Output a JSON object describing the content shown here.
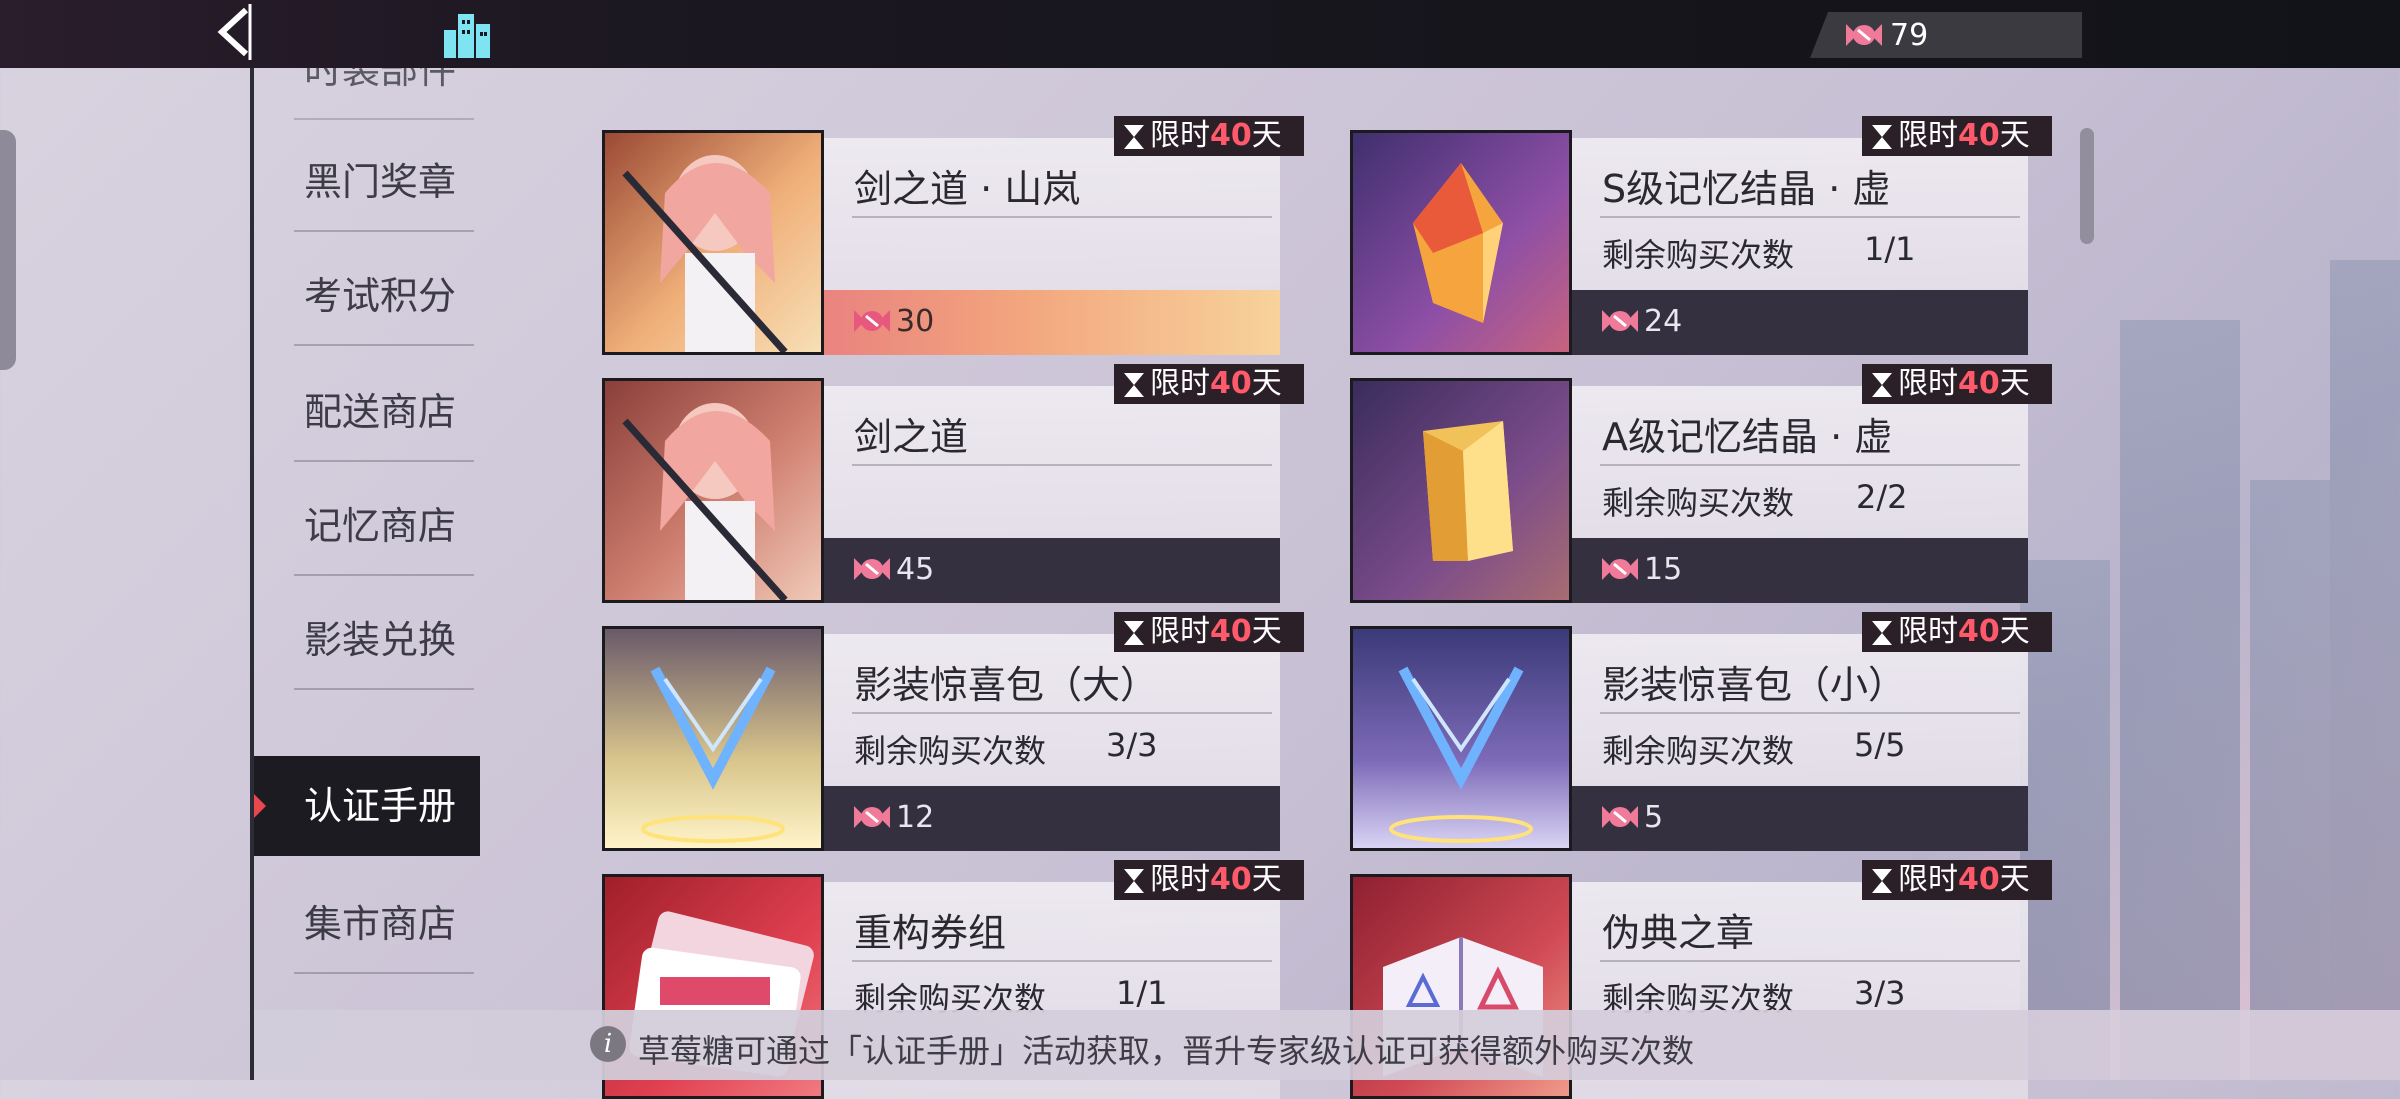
{
  "topbar": {
    "currency_value": "79",
    "back_icon": "chevron-left-icon",
    "home_icon": "city-icon",
    "currency_icon": "candy-icon"
  },
  "sidebar": {
    "items": [
      {
        "label": "时装部件",
        "partial": true
      },
      {
        "label": "黑门奖章"
      },
      {
        "label": "考试积分"
      },
      {
        "label": "配送商店"
      },
      {
        "label": "记忆商店"
      },
      {
        "label": "影装兑换"
      },
      {
        "label": "认证手册",
        "active": true
      },
      {
        "label": "集市商店"
      }
    ]
  },
  "tag": {
    "prefix": "限时",
    "days": "40",
    "suffix": "天"
  },
  "cards": [
    {
      "name": "剑之道 · 山岚",
      "remain_label": "",
      "remain": "",
      "price": "30",
      "style": "gold"
    },
    {
      "name": "S级记忆结晶 · 虚",
      "remain_label": "剩余购买次数",
      "remain": "1/1",
      "price": "24"
    },
    {
      "name": "剑之道",
      "remain_label": "",
      "remain": "",
      "price": "45"
    },
    {
      "name": "A级记忆结晶 · 虚",
      "remain_label": "剩余购买次数",
      "remain": "2/2",
      "price": "15"
    },
    {
      "name": "影装惊喜包（大）",
      "remain_label": "剩余购买次数",
      "remain": "3/3",
      "price": "12"
    },
    {
      "name": "影装惊喜包（小）",
      "remain_label": "剩余购买次数",
      "remain": "5/5",
      "price": "5"
    },
    {
      "name": "重构券组",
      "remain_label": "剩余购买次数",
      "remain": "1/1",
      "price": ""
    },
    {
      "name": "伪典之章",
      "remain_label": "剩余购买次数",
      "remain": "3/3",
      "price": ""
    }
  ],
  "footer": {
    "tip": "草莓糖可通过「认证手册」活动获取，晋升专家级认证可获得额外购买次数"
  },
  "colors": {
    "accent": "#e8474e",
    "tag_days": "#ff5a6b",
    "price_bar": "#34303f"
  }
}
